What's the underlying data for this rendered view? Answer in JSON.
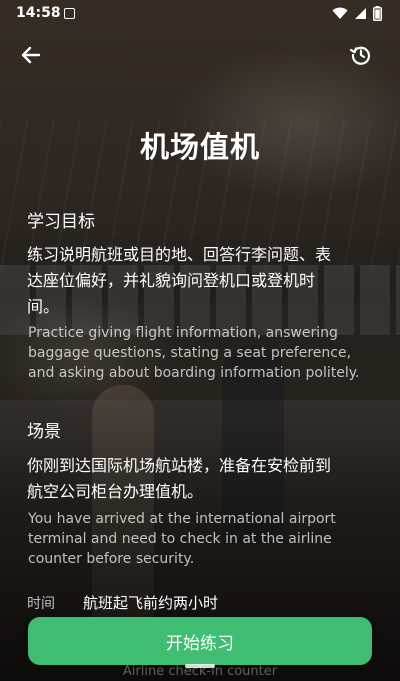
{
  "status_bar": {
    "time": "14:58"
  },
  "nav": {
    "back_icon": "arrow-left-icon",
    "history_icon": "history-icon"
  },
  "title": "机场值机",
  "objective": {
    "heading": "学习目标",
    "zh_line1": "练习说明航班或目的地、回答行李问题、表",
    "zh_line2": "达座位偏好，并礼貌询问登机口或登机时",
    "zh_line3": "间。",
    "en_line1": "Practice giving flight information, answering",
    "en_line2": "baggage questions, stating a seat preference,",
    "en_line3": "and asking about boarding information politely."
  },
  "scenario": {
    "heading": "场景",
    "zh_line1": "你刚到达国际机场航站楼，准备在安检前到",
    "zh_line2": "航空公司柜台办理值机。",
    "en_line1": "You have arrived at the international airport",
    "en_line2": "terminal and need to check in at the airline",
    "en_line3": "counter before security."
  },
  "time_info": {
    "label": "时间",
    "value": "航班起飞前约两小时"
  },
  "hint": "Airline check-in counter",
  "start_button": {
    "label": "开始练习"
  },
  "colors": {
    "accent": "#3fbe73"
  }
}
